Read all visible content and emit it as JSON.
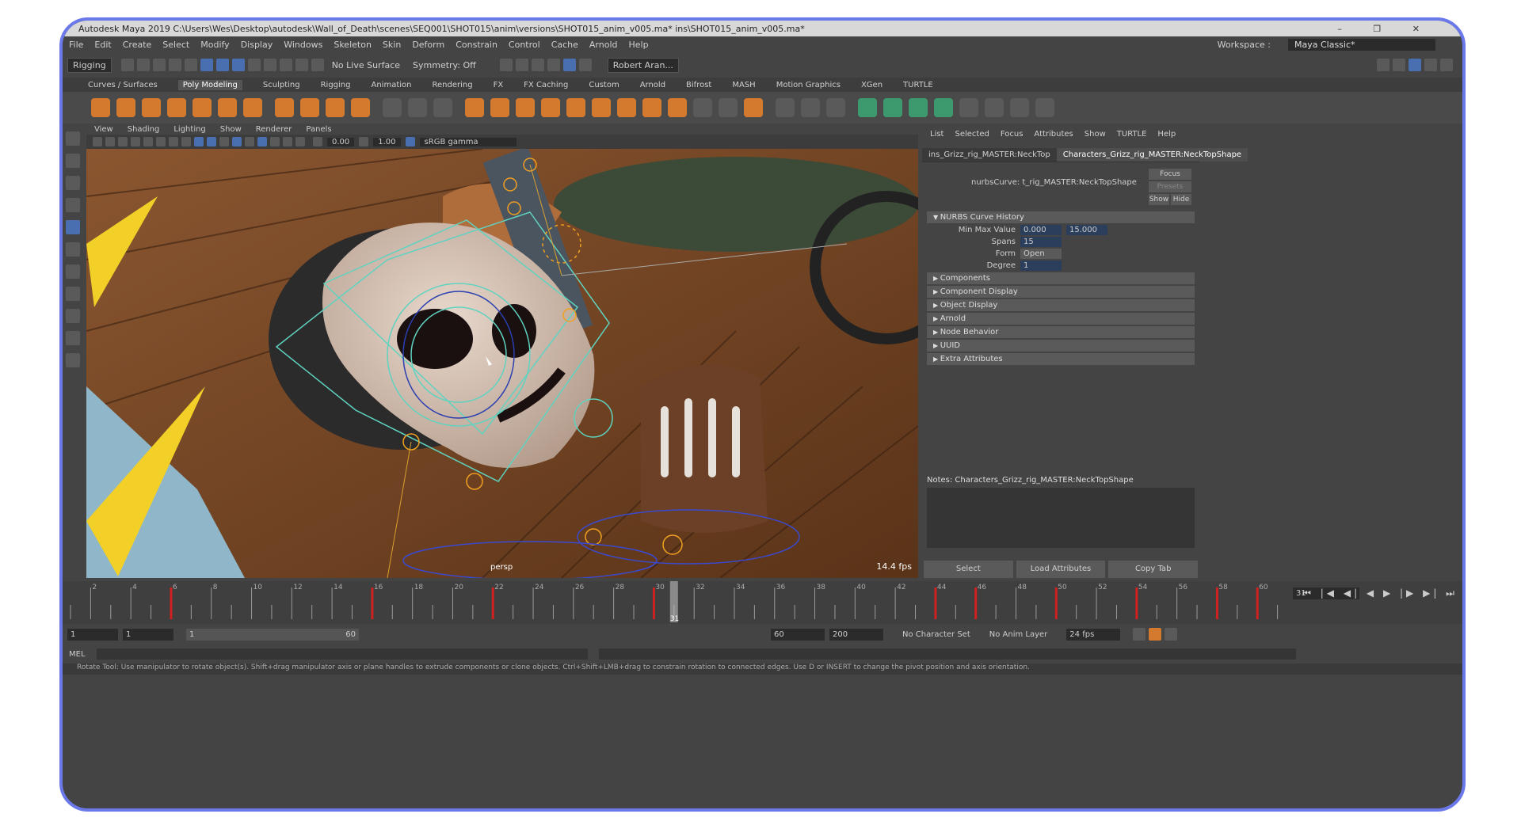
{
  "window": {
    "title": "Autodesk Maya 2019  C:\\Users\\Wes\\Desktop\\autodesk\\Wall_of_Death\\scenes\\SEQ001\\SHOT015\\anim\\versions\\SHOT015_anim_v005.ma*   ins\\SHOT015_anim_v005.ma*"
  },
  "menubar": {
    "items": [
      "File",
      "Edit",
      "Create",
      "Select",
      "Modify",
      "Display",
      "Windows",
      "Skeleton",
      "Skin",
      "Deform",
      "Constrain",
      "Control",
      "Cache",
      "Arnold",
      "Help"
    ],
    "workspace_label": "Workspace :",
    "workspace_value": "Maya Classic*"
  },
  "statusline": {
    "mode": "Rigging",
    "live_surface": "No Live Surface",
    "symmetry": "Symmetry: Off",
    "user": "Robert Aran..."
  },
  "shelf_tabs": [
    "Curves / Surfaces",
    "Poly Modeling",
    "Sculpting",
    "Rigging",
    "Animation",
    "Rendering",
    "FX",
    "FX Caching",
    "Custom",
    "Arnold",
    "Bifrost",
    "MASH",
    "Motion Graphics",
    "XGen",
    "TURTLE"
  ],
  "shelf_active": "Poly Modeling",
  "viewport": {
    "menu": [
      "View",
      "Shading",
      "Lighting",
      "Show",
      "Renderer",
      "Panels"
    ],
    "exposure": "0.00",
    "gamma": "1.00",
    "colorspace": "sRGB gamma",
    "camera": "persp",
    "fps": "14.4 fps"
  },
  "attr_editor": {
    "menu": [
      "List",
      "Selected",
      "Focus",
      "Attributes",
      "Show",
      "TURTLE",
      "Help"
    ],
    "tabs": [
      "ins_Grizz_rig_MASTER:NeckTop",
      "Characters_Grizz_rig_MASTER:NeckTopShape"
    ],
    "node_label": "nurbsCurve:",
    "node_value": "t_rig_MASTER:NeckTopShape",
    "focus_btn": "Focus",
    "presets_btn": "Presets",
    "show_btn": "Show",
    "hide_btn": "Hide",
    "section_history": "NURBS Curve History",
    "fields": {
      "minmax_label": "Min Max Value",
      "min": "0.000",
      "max": "15.000",
      "spans_label": "Spans",
      "spans": "15",
      "form_label": "Form",
      "form": "Open",
      "degree_label": "Degree",
      "degree": "1"
    },
    "sections": [
      "Components",
      "Component Display",
      "Object Display",
      "Arnold",
      "Node Behavior",
      "UUID",
      "Extra Attributes"
    ],
    "notes": "Notes:  Characters_Grizz_rig_MASTER:NeckTopShape",
    "buttons": [
      "Select",
      "Load Attributes",
      "Copy Tab"
    ]
  },
  "timeline": {
    "ticks": [
      "2",
      "4",
      "6",
      "8",
      "10",
      "12",
      "14",
      "16",
      "18",
      "20",
      "22",
      "24",
      "26",
      "28",
      "30",
      "32",
      "34",
      "36",
      "38",
      "40",
      "42",
      "44",
      "46",
      "48",
      "50",
      "52",
      "54",
      "56",
      "58",
      "60"
    ],
    "current": "31",
    "current_field": "31"
  },
  "range": {
    "start": "1",
    "anim_start": "1",
    "slider_start": "1",
    "slider_end": "60",
    "end": "60",
    "anim_end": "200",
    "character_set": "No Character Set",
    "anim_layer": "No Anim Layer",
    "fps": "24 fps"
  },
  "cmdline": {
    "label": "MEL"
  },
  "help_line": "Rotate Tool: Use manipulator to rotate object(s). Shift+drag manipulator axis or plane handles to extrude components or clone objects. Ctrl+Shift+LMB+drag to constrain rotation to connected edges. Use D or INSERT to change the pivot position and axis orientation."
}
